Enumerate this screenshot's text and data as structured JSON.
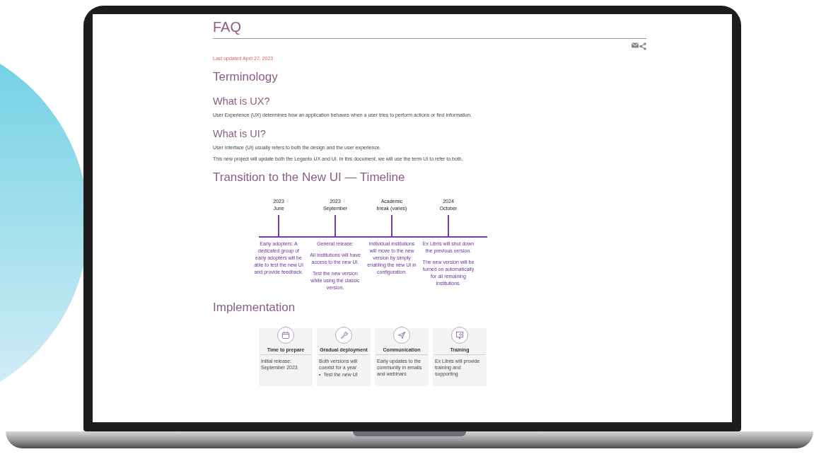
{
  "page": {
    "title": "FAQ",
    "last_updated": "Last updated April 27, 2023",
    "sections": [
      {
        "kind": "heading",
        "text": "Terminology"
      },
      {
        "kind": "subheading",
        "text": "What is UX?"
      },
      {
        "kind": "paragraph",
        "text": "User Experience (UX) determines how an application behaves when a user tries to perform actions or find information."
      },
      {
        "kind": "subheading",
        "text": "What is UI?"
      },
      {
        "kind": "paragraph",
        "text": "User Interface (UI) usually refers to both the design and the user experience."
      },
      {
        "kind": "paragraph",
        "text": "This new project will update both the Leganto UX and UI. In this document, we will use the term UI to refer to both."
      },
      {
        "kind": "heading",
        "text": "Transition to the New UI — Timeline"
      },
      {
        "kind": "timeline",
        "milestones": [
          {
            "date": [
              "2023",
              "June"
            ],
            "paragraphs": [
              "Early adopters: A dedicated group of early adopters will be able to test the new UI and provide feedback."
            ]
          },
          {
            "date": [
              "2023",
              "September"
            ],
            "paragraphs": [
              "General release:",
              "All institutions will have access to the new UI.",
              "Test the new version while using the classic version."
            ]
          },
          {
            "date": [
              "Academic",
              "break (varies)"
            ],
            "paragraphs": [
              "Individual institutions will move to the new version by simply enabling the new UI in configuration."
            ]
          },
          {
            "date": [
              "2024",
              "October"
            ],
            "paragraphs": [
              "Ex Libris will shut down the previous version.",
              "The new version will be turned on automatically for all remaining institutions."
            ]
          }
        ]
      },
      {
        "kind": "heading",
        "text": "Implementation"
      },
      {
        "kind": "cards",
        "cards": [
          {
            "title": "Time to prepare",
            "text": "Initial release: September 2023"
          },
          {
            "title": "Gradual deployment",
            "text": "Both versions will coexist for a year",
            "bullets": [
              {
                "marker": "•",
                "text": "Test the new UI"
              }
            ]
          },
          {
            "title": "Communication",
            "text": "Early updates to the community in emails and webinars"
          },
          {
            "title": "Training",
            "text": "Ex Libris will provide training and supporting"
          }
        ]
      }
    ]
  }
}
